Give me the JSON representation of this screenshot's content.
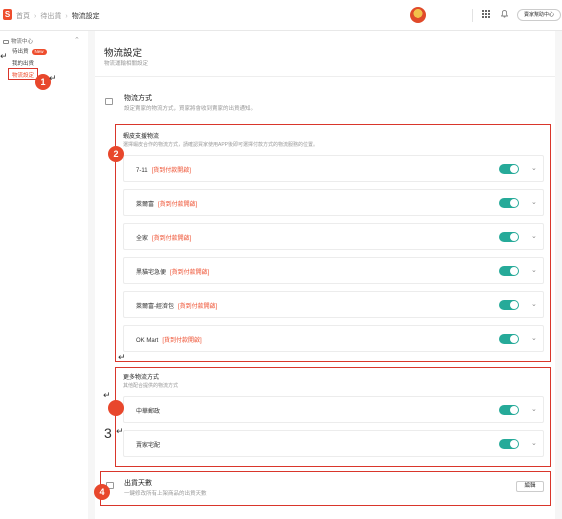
{
  "topbar": {
    "logo": "S",
    "breadcrumb": [
      "首頁",
      "待出貨",
      "物流設定"
    ],
    "help_label": "賣家幫助中心"
  },
  "sidebar": {
    "section_label": "物流中心",
    "items": [
      {
        "label": "待出貨",
        "badge": "New"
      },
      {
        "label": "我的出貨"
      },
      {
        "label": "物流設定"
      }
    ]
  },
  "page": {
    "title": "物流設定",
    "subtitle": "物流運輸相關設定"
  },
  "shipping_methods": {
    "title": "物流方式",
    "description": "設定賣家的物流方式，買家將會收到賣家的出貨通知。"
  },
  "shopee_logistics": {
    "title": "蝦皮支援物流",
    "description": "選擇蝦皮合作的物流方式，請確認買家使用APP後即可選擇付款方式的物流服務的位置。",
    "rows": [
      {
        "name": "7-11",
        "link": "[貨到付款開啟]",
        "enabled": true
      },
      {
        "name": "萊爾富",
        "link": "[貨到付款開啟]",
        "enabled": true
      },
      {
        "name": "全家",
        "link": "[貨到付款開啟]",
        "enabled": true
      },
      {
        "name": "黑貓宅急便",
        "link": "[貨到付款開啟]",
        "enabled": true
      },
      {
        "name": "萊爾富-經濟包",
        "link": "[貨到付款開啟]",
        "enabled": true
      },
      {
        "name": "OK Mart",
        "link": "[貨到付款開啟]",
        "enabled": true
      }
    ]
  },
  "more_logistics": {
    "title": "更多物流方式",
    "description": "其他配合提供的物流方式",
    "rows": [
      {
        "name": "中華郵政",
        "enabled": true
      },
      {
        "name": "賣家宅配",
        "enabled": true
      }
    ]
  },
  "ship_days": {
    "title": "出貨天數",
    "description": "一鍵修改所有上架商品的出貨天數",
    "edit_label": "編輯"
  },
  "annotations": {
    "marker_1": "1",
    "marker_2": "2",
    "marker_3": "3",
    "marker_4": "4",
    "return_mark": "↵"
  },
  "colors": {
    "brand": "#ee4d2d",
    "toggle_on": "#26aa99",
    "annotation": "#d9362b"
  }
}
